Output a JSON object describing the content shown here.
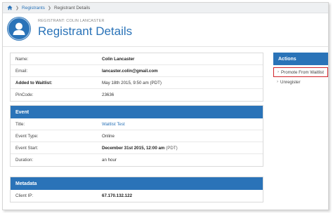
{
  "breadcrumb": {
    "items": [
      {
        "label": "Registrants",
        "link": true
      },
      {
        "label": "Registrant Details",
        "link": false
      }
    ]
  },
  "header": {
    "subtitle": "REGISTRANT: COLIN LANCASTER",
    "title": "Registrant Details"
  },
  "registrant": {
    "rows": [
      {
        "key": "Name:",
        "value": "Colin Lancaster"
      },
      {
        "key": "Email:",
        "value": "lancaster.colin@gmail.com"
      },
      {
        "key": "Added to Waitlist:",
        "value": "May 18th 2015, 9:50 am (PDT)"
      },
      {
        "key": "PinCode:",
        "value": "23636"
      }
    ]
  },
  "event": {
    "heading": "Event",
    "rows": [
      {
        "key": "Title:",
        "value": "Waitlist Test"
      },
      {
        "key": "Event Type:",
        "value": "Online"
      },
      {
        "key": "Event Start:",
        "value": "December 31st 2015, 12:00 am",
        "tz": "(PDT)"
      },
      {
        "key": "Duration:",
        "value": "an hour"
      }
    ]
  },
  "metadata": {
    "heading": "Metadata",
    "rows": [
      {
        "key": "Client IP:",
        "value": "67.170.132.122"
      }
    ]
  },
  "actions": {
    "heading": "Actions",
    "items": [
      {
        "label": "Promote From Waitlist"
      },
      {
        "label": "Unregister"
      }
    ]
  },
  "colors": {
    "accent": "#2a73b8",
    "highlight_border": "#d0232a"
  }
}
